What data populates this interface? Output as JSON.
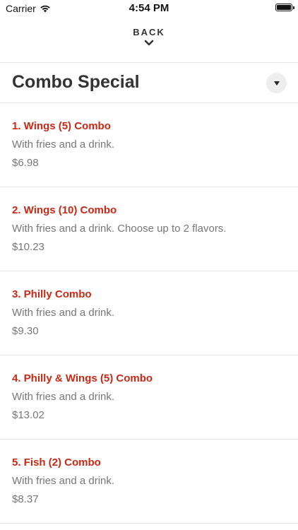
{
  "status_bar": {
    "carrier": "Carrier",
    "time": "4:54 PM"
  },
  "nav": {
    "back_label": "BACK"
  },
  "section": {
    "title": "Combo Special"
  },
  "colors": {
    "item_name": "#c62a16",
    "text_muted": "#777777",
    "divider": "#e6e6e6"
  },
  "items": [
    {
      "name": "1. Wings (5) Combo",
      "description": "With fries and a drink.",
      "price": "$6.98"
    },
    {
      "name": "2. Wings (10) Combo",
      "description": "With fries and a drink. Choose up to 2 flavors.",
      "price": "$10.23"
    },
    {
      "name": "3. Philly Combo",
      "description": "With fries and a drink.",
      "price": "$9.30"
    },
    {
      "name": "4. Philly & Wings (5) Combo",
      "description": "With fries and a drink.",
      "price": "$13.02"
    },
    {
      "name": "5. Fish (2) Combo",
      "description": "With fries and a drink.",
      "price": "$8.37"
    }
  ]
}
